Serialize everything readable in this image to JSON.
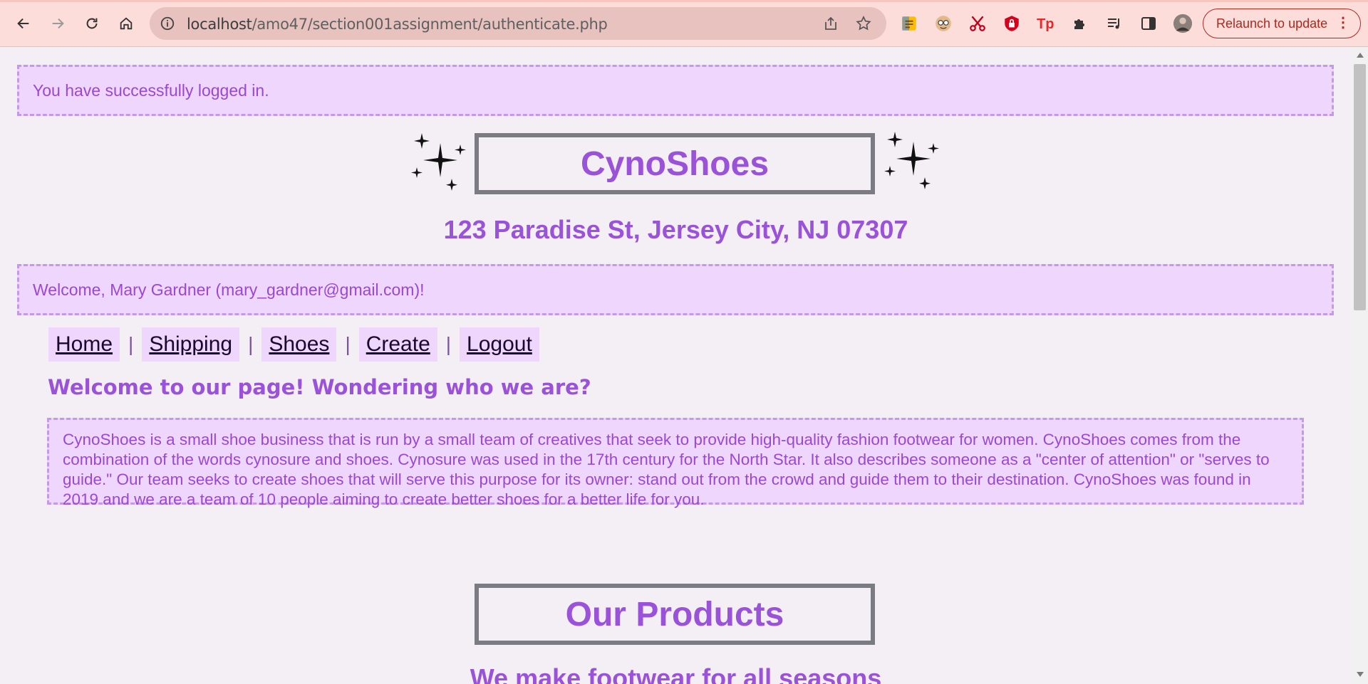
{
  "browser": {
    "url_host": "localhost",
    "url_path": "/amo47/section001assignment/authenticate.php",
    "relaunch_label": "Relaunch to update",
    "relaunch_menu": "⋮"
  },
  "page": {
    "login_message": "You have successfully logged in.",
    "brand": "CynoShoes",
    "address": "123 Paradise St, Jersey City, NJ 07307",
    "welcome_message": "Welcome, Mary Gardner (mary_gardner@gmail.com)!",
    "nav": {
      "home": "Home",
      "shipping": "Shipping",
      "shoes": "Shoes",
      "create": "Create",
      "logout": "Logout",
      "separator": "|"
    },
    "about_heading": "Welcome to our page! Wondering who we are?",
    "about_text": "CynoShoes is a small shoe business that is run by a small team of creatives that seek to provide high-quality fashion footwear for women. CynoShoes comes from the combination of the words cynosure and shoes. Cynosure was used in the 17th century for the North Star. It also describes someone as a \"center of attention\" or \"serves to guide.\" Our team seeks to create shoes that will serve this purpose for its owner: stand out from the crowd and guide them to their destination. CynoShoes was found in 2019 and we are a team of 10 people aiming to create better shoes for a better life for you.",
    "products_title": "Our Products",
    "products_subtitle": "We make footwear for all seasons"
  },
  "colors": {
    "accent_purple": "#9a52d8",
    "message_bg": "#efd6fc",
    "message_border": "#c49ae8",
    "chrome_bg": "#fcddd9"
  }
}
